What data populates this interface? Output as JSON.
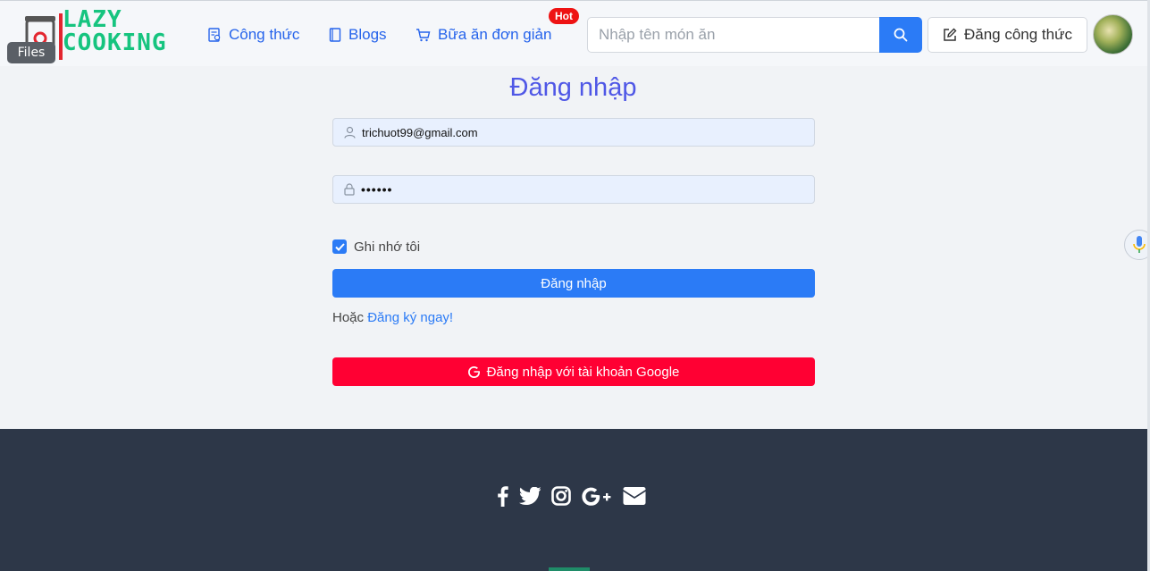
{
  "header": {
    "logo_line1": "LAZY",
    "logo_line2": "COOKING",
    "files_badge": "Files",
    "nav": [
      {
        "label": "Công thức",
        "icon": "recipe-icon"
      },
      {
        "label": "Blogs",
        "icon": "book-icon"
      },
      {
        "label": "Bữa ăn đơn giản",
        "icon": "cart-icon"
      }
    ],
    "hot_badge": "Hot",
    "search_placeholder": "Nhập tên món ăn",
    "post_button": "Đăng công thức"
  },
  "login": {
    "title": "Đăng nhập",
    "email_value": "trichuot99@gmail.com",
    "password_value": "••••••",
    "remember_label": "Ghi nhớ tôi",
    "remember_checked": true,
    "submit_label": "Đăng nhập",
    "or_text": "Hoặc ",
    "register_link": "Đăng ký ngay!",
    "google_label": "Đăng nhập với tài khoản Google"
  },
  "footer": {
    "socials": [
      "facebook-icon",
      "twitter-icon",
      "instagram-icon",
      "google-plus-icon",
      "envelope-icon"
    ]
  },
  "colors": {
    "primary": "#2b7bf6",
    "brand_green": "#16c47f",
    "google_red": "#ff0033",
    "title_purple": "#4f57e6",
    "footer_bg": "#2d3748"
  }
}
